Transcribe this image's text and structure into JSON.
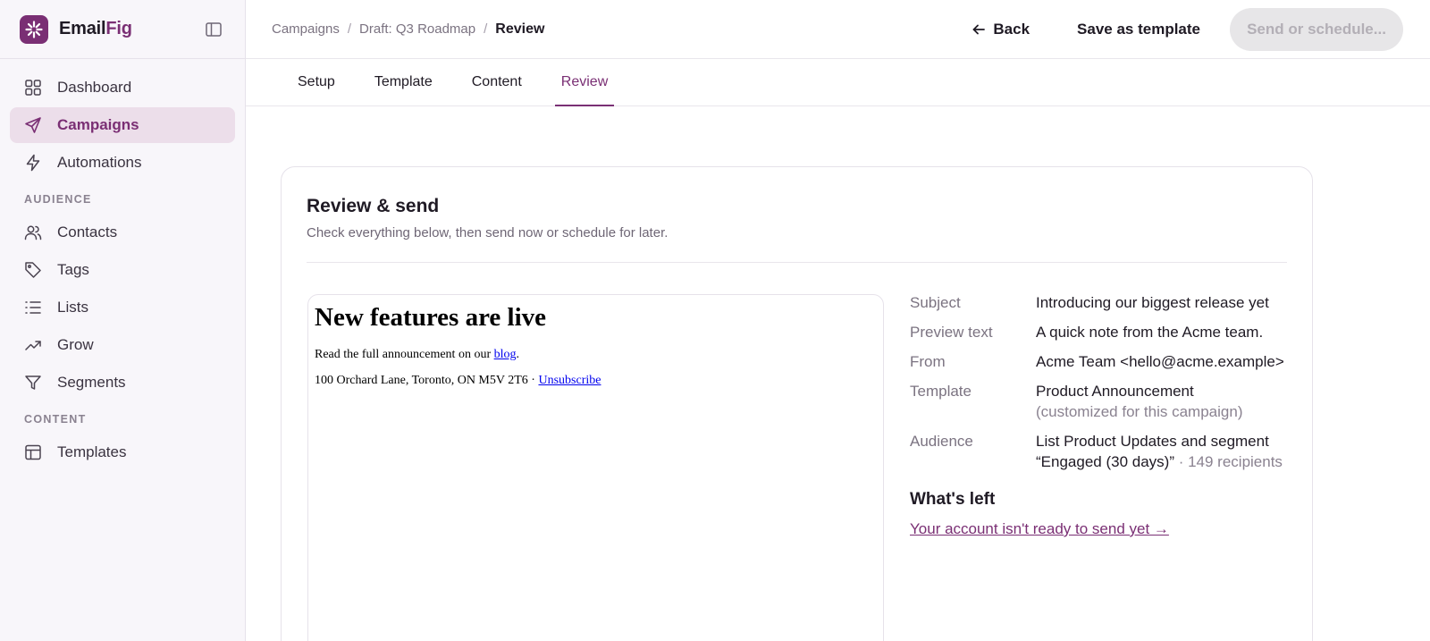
{
  "brand": {
    "name_part1": "Email",
    "name_part2": "Fig",
    "accent": "#7a2f74"
  },
  "sidebar": {
    "items": [
      {
        "label": "Dashboard",
        "icon": "grid-icon"
      },
      {
        "label": "Campaigns",
        "icon": "send-icon",
        "active": true
      },
      {
        "label": "Automations",
        "icon": "bolt-icon"
      }
    ],
    "audience_label": "AUDIENCE",
    "audience_items": [
      {
        "label": "Contacts",
        "icon": "users-icon"
      },
      {
        "label": "Tags",
        "icon": "tag-icon"
      },
      {
        "label": "Lists",
        "icon": "list-icon"
      },
      {
        "label": "Grow",
        "icon": "trending-up-icon"
      },
      {
        "label": "Segments",
        "icon": "filter-icon"
      }
    ],
    "content_label": "CONTENT",
    "content_items": [
      {
        "label": "Templates",
        "icon": "layout-icon"
      }
    ]
  },
  "breadcrumb": {
    "root": "Campaigns",
    "parent": "Draft: Q3 Roadmap",
    "current": "Review"
  },
  "toolbar": {
    "back_label": "Back",
    "save_template_label": "Save as template",
    "send_label": "Send or schedule..."
  },
  "tabs": [
    {
      "label": "Setup"
    },
    {
      "label": "Template"
    },
    {
      "label": "Content"
    },
    {
      "label": "Review",
      "active": true
    }
  ],
  "review": {
    "title": "Review & send",
    "subtitle": "Check everything below, then send now or schedule for later.",
    "preview": {
      "heading": "New features are live",
      "body_prefix": "Read the full announcement on our ",
      "body_link": "blog",
      "body_suffix": ".",
      "footer_address": "100 Orchard Lane, Toronto, ON M5V 2T6 · ",
      "footer_link": "Unsubscribe"
    },
    "details": {
      "subject_label": "Subject",
      "subject_value": "Introducing our biggest release yet",
      "preview_label": "Preview text",
      "preview_value": "A quick note from the Acme team.",
      "from_label": "From",
      "from_value": "Acme Team <hello@acme.example>",
      "template_label": "Template",
      "template_value": "Product Announcement",
      "template_note": "(customized for this campaign)",
      "audience_label": "Audience",
      "audience_value": "List Product Updates and segment “Engaged (30 days)”",
      "audience_count": " · 149 recipients"
    },
    "whats_left_title": "What's left",
    "whats_left_link": "Your account isn't ready to send yet →"
  }
}
